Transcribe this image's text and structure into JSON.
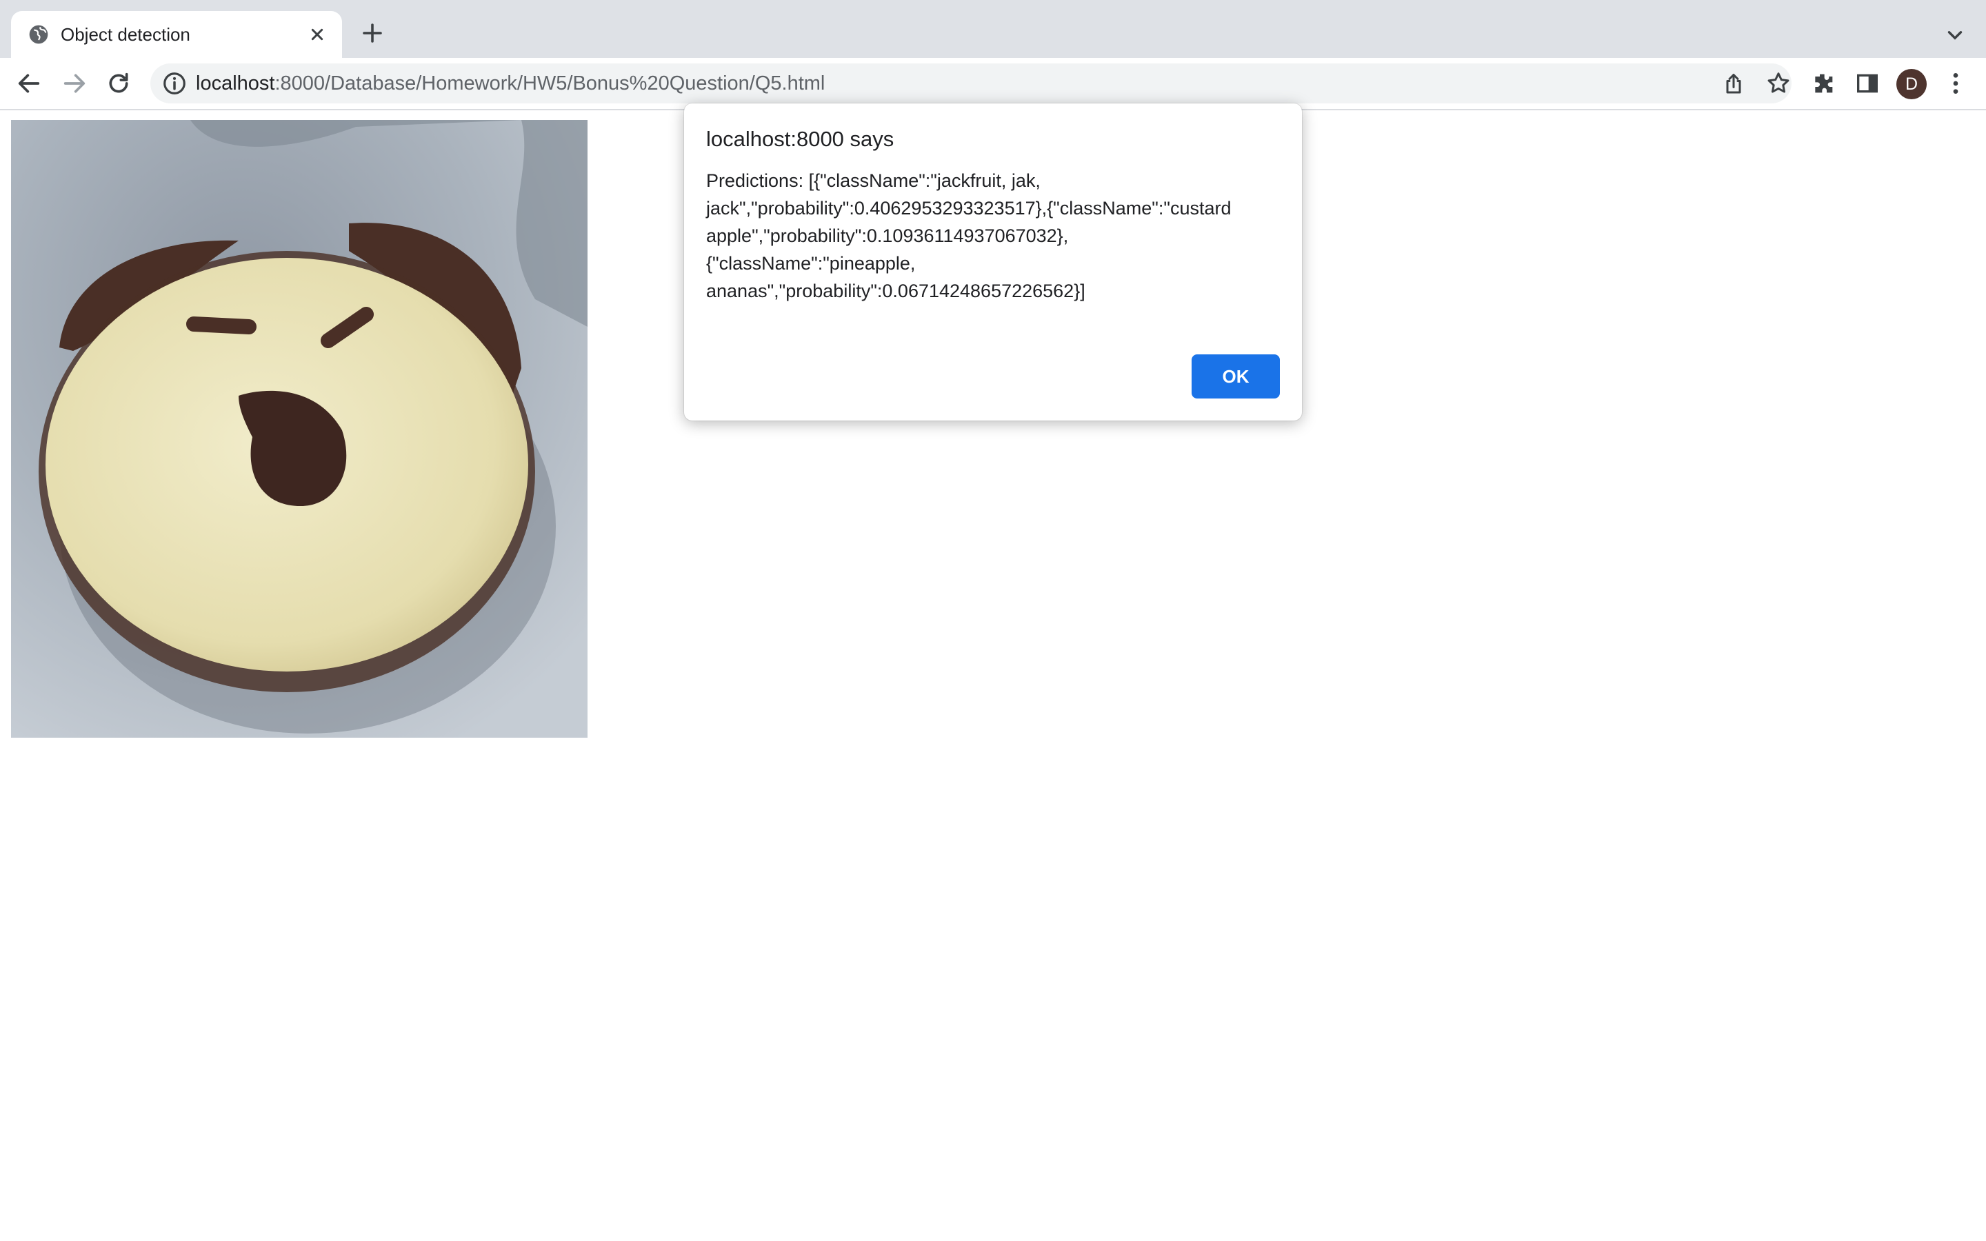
{
  "browser": {
    "tab": {
      "title": "Object detection",
      "favicon": "globe-icon"
    },
    "omnibox": {
      "host": "localhost",
      "rest": ":8000/Database/Homework/HW5/Bonus%20Question/Q5.html"
    },
    "profile_initial": "D",
    "icons": [
      "back-icon",
      "forward-icon",
      "reload-icon",
      "info-icon",
      "share-icon",
      "star-icon",
      "extensions-icon",
      "side-panel-icon",
      "menu-icon",
      "new-tab-icon",
      "tab-search-icon",
      "close-icon"
    ]
  },
  "page": {
    "image": {
      "subject": "cookie-face",
      "colors": {
        "background": "#aeb7c1",
        "dough": "#ece6bf",
        "chocolate": "#4a2f26"
      }
    }
  },
  "dialog": {
    "title": "localhost:8000 says",
    "message": "Predictions: [{\"className\":\"jackfruit, jak,\njack\",\"probability\":0.4062953293323517},{\"className\":\"custard\napple\",\"probability\":0.10936114937067032},\n{\"className\":\"pineapple,\nananas\",\"probability\":0.06714248657226562}]",
    "ok_label": "OK",
    "accent": "#1a73e8"
  }
}
